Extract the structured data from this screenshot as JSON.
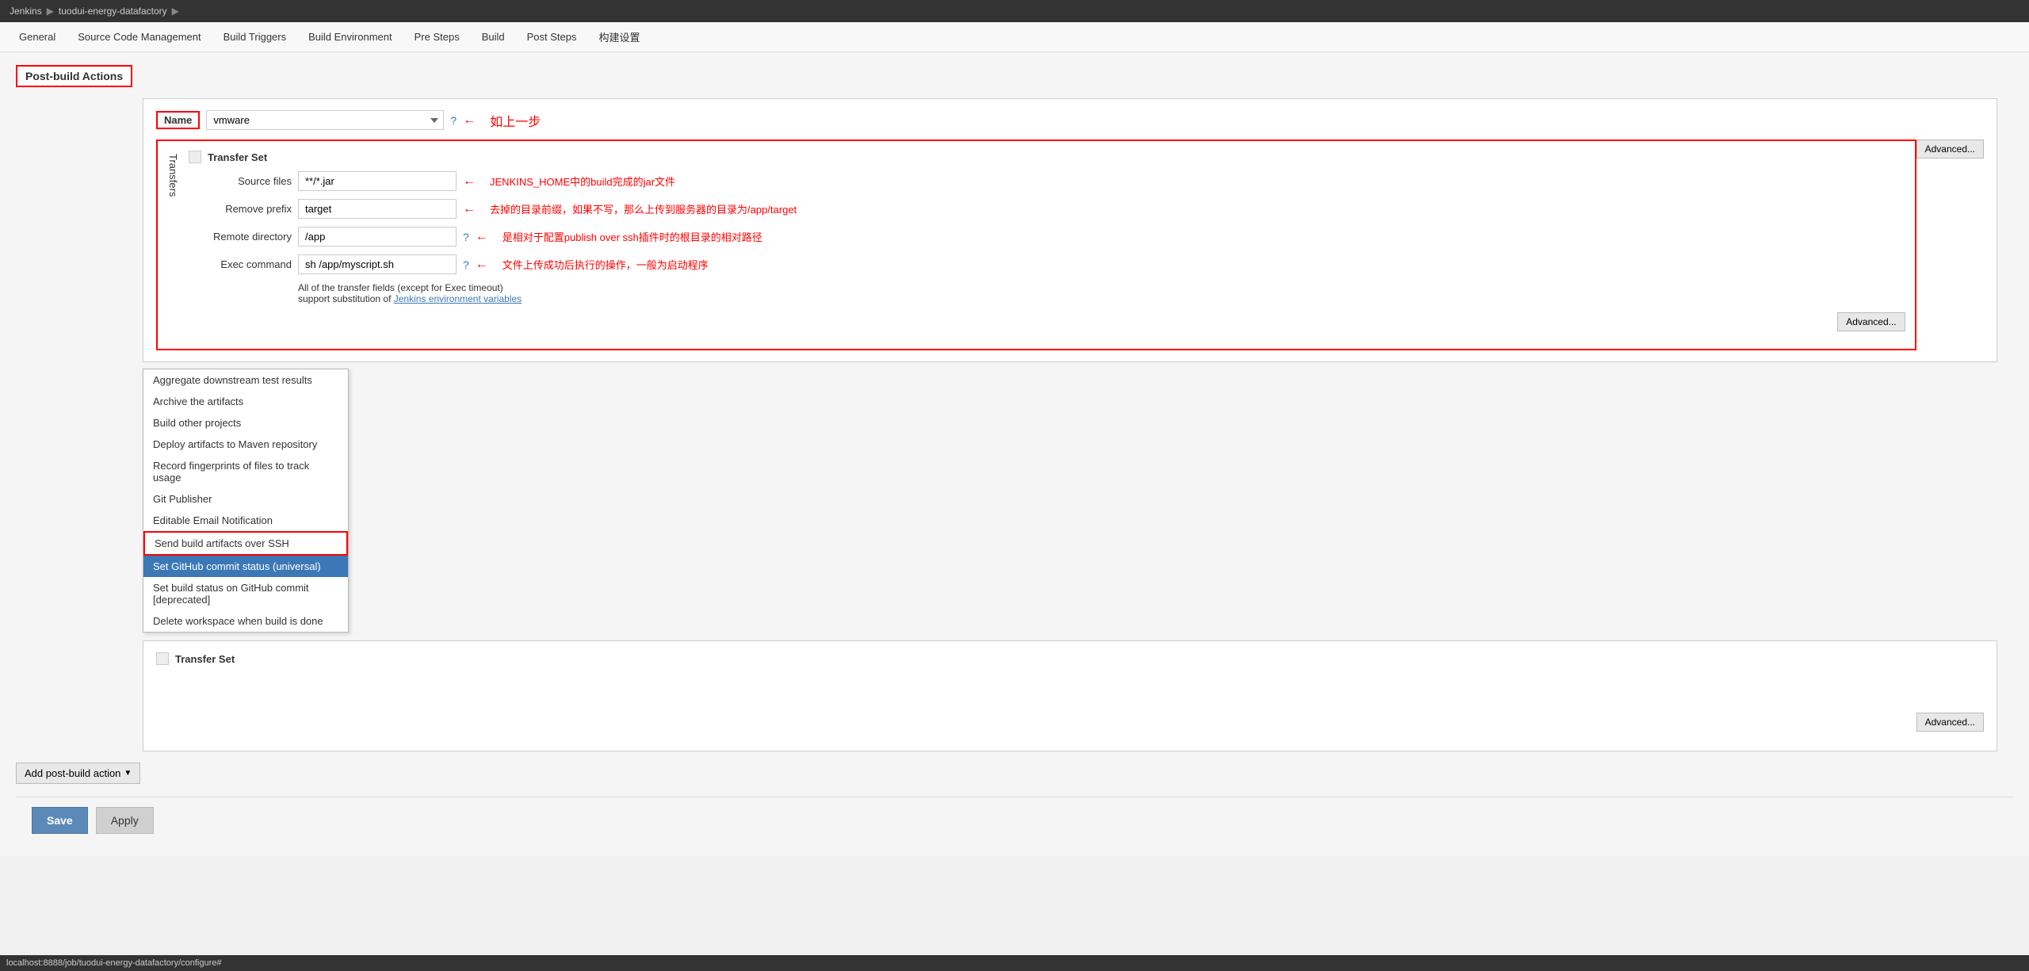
{
  "topbar": {
    "jenkins": "Jenkins",
    "sep1": "▶",
    "project": "tuodui-energy-datafactory",
    "sep2": "▶"
  },
  "tabs": [
    {
      "label": "General"
    },
    {
      "label": "Source Code Management"
    },
    {
      "label": "Build Triggers"
    },
    {
      "label": "Build Environment"
    },
    {
      "label": "Pre Steps"
    },
    {
      "label": "Build"
    },
    {
      "label": "Post Steps"
    },
    {
      "label": "构建设置"
    }
  ],
  "postBuild": {
    "sectionLabel": "Post-build Actions",
    "nameLabel": "Name",
    "nameValue": "vmware",
    "advancedBtn": "Advanced...",
    "advancedBtn2": "Advanced...",
    "advancedBtn3": "Advanced...",
    "annotations": {
      "arrow1": "←",
      "text1": "如上一步",
      "sourceFilesLabel": "Source files",
      "sourceFilesValue": "**/*.jar",
      "sourceFilesAnnotation": "JENKINS_HOME中的build完成的jar文件",
      "removePrefixLabel": "Remove prefix",
      "removePrefixValue": "target",
      "removePrefixAnnotation": "去掉的目录前缀，如果不写，那么上传到服务器的目录为/app/target",
      "remoteDirectoryLabel": "Remote directory",
      "remoteDirectoryValue": "/app",
      "remoteDirectoryAnnotation": "是相对于配置publish over ssh插件时的根目录的相对路径",
      "execCommandLabel": "Exec command",
      "execCommandValue": "sh /app/myscript.sh",
      "execCommandAnnotation": "文件上传成功后执行的操作，一般为启动程序"
    },
    "transfersLabel": "Transfers",
    "transferSetLabel": "Transfer Set",
    "footerLine1": "All of the transfer fields (except for Exec timeout)",
    "footerLine2": "support substitution of ",
    "footerLink": "Jenkins environment variables",
    "transferSetLabel2": "Transfer Set"
  },
  "dropdown": {
    "items": [
      {
        "label": "Aggregate downstream test results",
        "state": "normal"
      },
      {
        "label": "Archive the artifacts",
        "state": "normal"
      },
      {
        "label": "Build other projects",
        "state": "normal"
      },
      {
        "label": "Deploy artifacts to Maven repository",
        "state": "normal"
      },
      {
        "label": "Record fingerprints of files to track usage",
        "state": "normal"
      },
      {
        "label": "Git Publisher",
        "state": "normal"
      },
      {
        "label": "Editable Email Notification",
        "state": "normal"
      },
      {
        "label": "Send build artifacts over SSH",
        "state": "outlined"
      },
      {
        "label": "Set GitHub commit status (universal)",
        "state": "highlighted"
      },
      {
        "label": "Set build status on GitHub commit [deprecated]",
        "state": "normal"
      },
      {
        "label": "Delete workspace when build is done",
        "state": "normal"
      }
    ]
  },
  "addAction": {
    "label": "Add post-build action"
  },
  "footer": {
    "saveLabel": "Save",
    "applyLabel": "Apply"
  },
  "statusBar": {
    "url": "localhost:8888/job/tuodui-energy-datafactory/configure#"
  }
}
